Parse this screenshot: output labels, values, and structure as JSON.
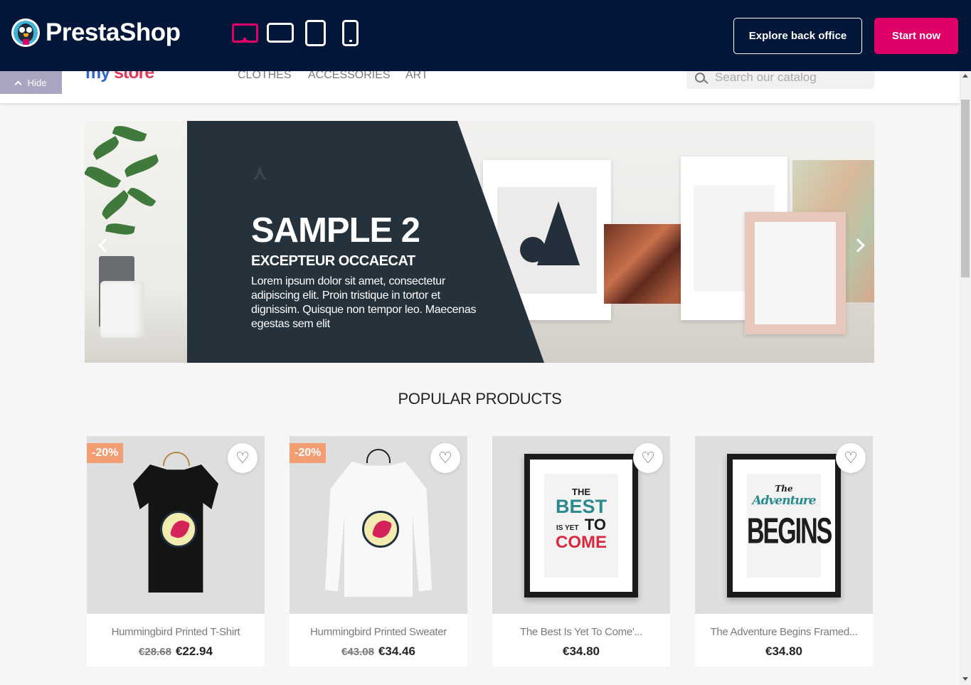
{
  "demo_bar": {
    "brand": "PrestaShop",
    "explore_label": "Explore back office",
    "start_label": "Start now",
    "accent": "#df0067",
    "background": "#011638"
  },
  "store": {
    "hide_label": "Hide",
    "logo_part1": "my",
    "logo_part2": "store",
    "nav": [
      "CLOTHES",
      "ACCESSORIES",
      "ART"
    ],
    "search_placeholder": "Search our catalog"
  },
  "slider": {
    "title": "SAMPLE 2",
    "subtitle": "EXCEPTEUR OCCAECAT",
    "text": "Lorem ipsum dolor sit amet, consectetur adipiscing elit. Proin tristique in tortor et dignissim. Quisque non tempor leo. Maecenas egestas sem elit"
  },
  "section_title": "POPULAR PRODUCTS",
  "products": [
    {
      "name": "Hummingbird Printed T-Shirt",
      "old_price": "€28.68",
      "price": "€22.94",
      "discount": "-20%"
    },
    {
      "name": "Hummingbird Printed Sweater",
      "old_price": "€43.08",
      "price": "€34.46",
      "discount": "-20%"
    },
    {
      "name": "The Best Is Yet To Come'...",
      "old_price": "",
      "price": "€34.80",
      "discount": ""
    },
    {
      "name": "The Adventure Begins Framed...",
      "old_price": "",
      "price": "€34.80",
      "discount": ""
    }
  ],
  "posters": {
    "best": [
      "THE",
      "BEST",
      "IS YET",
      "TO",
      "COME"
    ],
    "adventure": [
      "The",
      "Adventure",
      "BEGINS"
    ]
  }
}
